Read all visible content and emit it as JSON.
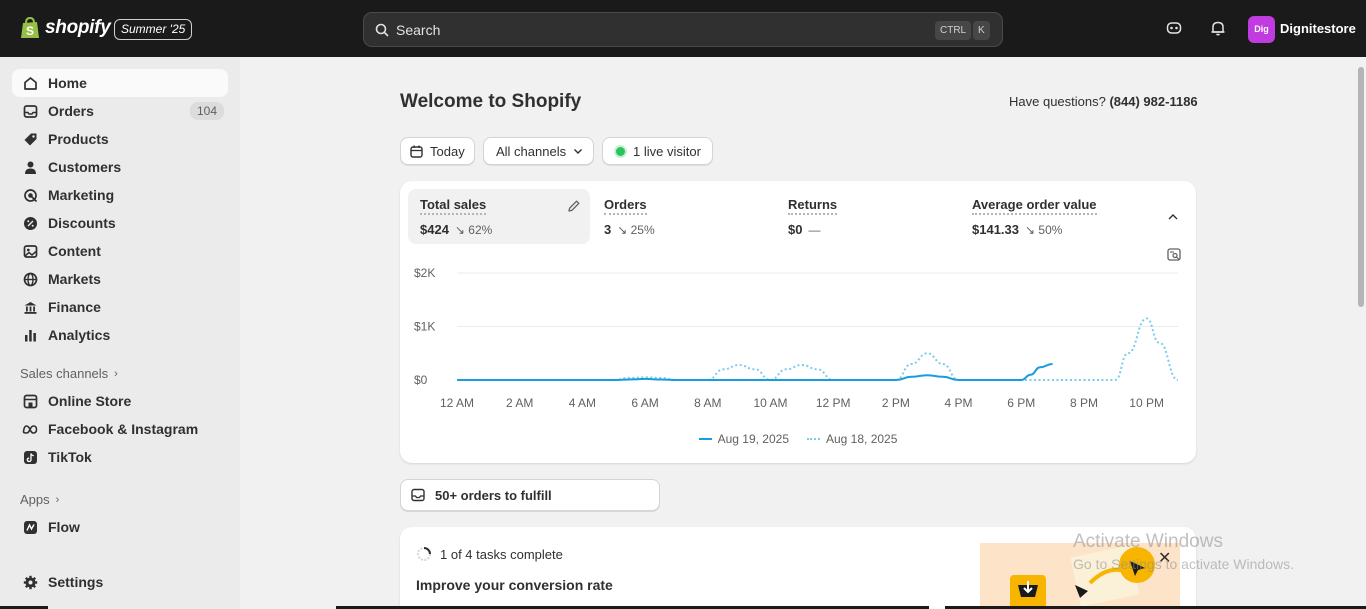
{
  "topbar": {
    "brand": "shopify",
    "edition": "Summer '25",
    "search_placeholder": "Search",
    "shortcut_ctrl": "CTRL",
    "shortcut_key": "K",
    "avatar_initials": "Dig",
    "store_name": "Dignitestore",
    "avatar_color": "#c13ce0"
  },
  "sidebar": {
    "items": [
      {
        "label": "Home",
        "icon": "home-icon"
      },
      {
        "label": "Orders",
        "icon": "inbox-icon",
        "count": "104"
      },
      {
        "label": "Products",
        "icon": "tag-icon"
      },
      {
        "label": "Customers",
        "icon": "person-icon"
      },
      {
        "label": "Marketing",
        "icon": "target-icon"
      },
      {
        "label": "Discounts",
        "icon": "discount-icon"
      },
      {
        "label": "Content",
        "icon": "content-icon"
      },
      {
        "label": "Markets",
        "icon": "globe-icon"
      },
      {
        "label": "Finance",
        "icon": "bank-icon"
      },
      {
        "label": "Analytics",
        "icon": "bar-chart-icon"
      }
    ],
    "sales_channels_heading": "Sales channels",
    "channels": [
      {
        "label": "Online Store",
        "icon": "store-icon"
      },
      {
        "label": "Facebook & Instagram",
        "icon": "meta-icon"
      },
      {
        "label": "TikTok",
        "icon": "tiktok-icon"
      }
    ],
    "apps_heading": "Apps",
    "apps": [
      {
        "label": "Flow",
        "icon": "flow-icon"
      }
    ],
    "settings_label": "Settings"
  },
  "main": {
    "title": "Welcome to Shopify",
    "help_text": "Have questions?",
    "help_phone": "(844) 982-1186",
    "filters": {
      "date": "Today",
      "channels": "All channels",
      "visitors": "1 live visitor"
    },
    "metrics": [
      {
        "label": "Total sales",
        "value": "$424",
        "change": "↘ 62%"
      },
      {
        "label": "Orders",
        "value": "3",
        "change": "↘ 25%"
      },
      {
        "label": "Returns",
        "value": "$0",
        "change": "—"
      },
      {
        "label": "Average order value",
        "value": "$141.33",
        "change": "↘ 50%"
      }
    ],
    "fulfill_label": "50+ orders to fulfill",
    "setup": {
      "progress": "1 of 4 tasks complete",
      "title": "Improve your conversion rate"
    }
  },
  "chart_data": {
    "type": "line",
    "title": "",
    "xlabel": "",
    "ylabel": "",
    "x_ticks": [
      "12 AM",
      "2 AM",
      "4 AM",
      "6 AM",
      "8 AM",
      "10 AM",
      "12 PM",
      "2 PM",
      "4 PM",
      "6 PM",
      "8 PM",
      "10 PM"
    ],
    "y_ticks": [
      "$0",
      "$1K",
      "$2K"
    ],
    "ylim": [
      0,
      2000
    ],
    "xlim": [
      0,
      23
    ],
    "grid": true,
    "legend_position": "bottom-center",
    "series": [
      {
        "name": "Aug 19, 2025",
        "style": "solid",
        "color": "#1a9ddb",
        "x": [
          0,
          1,
          2,
          3,
          4,
          5,
          5.5,
          6,
          6.5,
          7,
          8,
          9,
          10,
          11,
          12,
          13,
          14,
          14.5,
          15,
          15.5,
          16,
          17,
          18,
          18.3,
          18.6,
          19
        ],
        "y": [
          0,
          0,
          0,
          0,
          0,
          0,
          10,
          20,
          10,
          0,
          0,
          0,
          0,
          0,
          0,
          0,
          0,
          60,
          90,
          60,
          0,
          0,
          0,
          100,
          240,
          300
        ]
      },
      {
        "name": "Aug 18, 2025",
        "style": "dotted",
        "color": "#7ccbee",
        "x": [
          0,
          5,
          5.5,
          6,
          6.5,
          7,
          8,
          8.5,
          9,
          9.5,
          10,
          10.5,
          11,
          11.5,
          12,
          14,
          14.5,
          15,
          15.5,
          16,
          20,
          21,
          21.4,
          22,
          22.4,
          23
        ],
        "y": [
          0,
          0,
          40,
          50,
          40,
          0,
          0,
          200,
          280,
          200,
          0,
          200,
          280,
          200,
          0,
          0,
          300,
          500,
          300,
          0,
          0,
          0,
          500,
          1150,
          700,
          0
        ]
      }
    ]
  },
  "watermark": {
    "line1": "Activate Windows",
    "line2": "Go to Settings to activate Windows."
  }
}
